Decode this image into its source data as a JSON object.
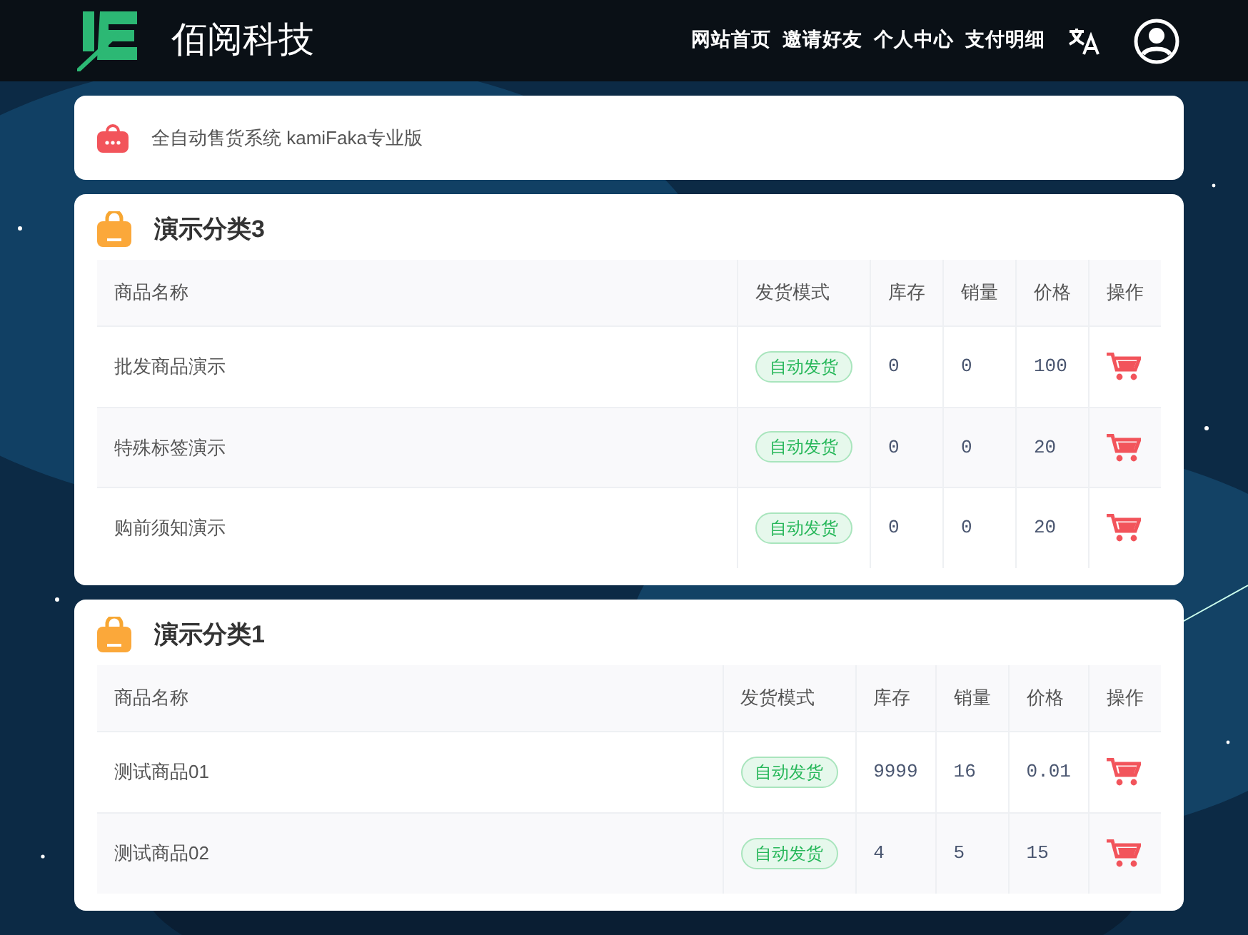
{
  "brand": {
    "title": "佰阅科技"
  },
  "nav": [
    "网站首页",
    "邀请好友",
    "个人中心",
    "支付明细"
  ],
  "notice": {
    "text": "全自动售货系统 kamiFaka专业版"
  },
  "categories": [
    {
      "title": "演示分类3",
      "columns": [
        "商品名称",
        "发货模式",
        "库存",
        "销量",
        "价格",
        "操作"
      ],
      "rows": [
        {
          "name": "批发商品演示",
          "mode": "自动发货",
          "stock": "0",
          "sales": "0",
          "price": "100"
        },
        {
          "name": "特殊标签演示",
          "mode": "自动发货",
          "stock": "0",
          "sales": "0",
          "price": "20"
        },
        {
          "name": "购前须知演示",
          "mode": "自动发货",
          "stock": "0",
          "sales": "0",
          "price": "20"
        }
      ]
    },
    {
      "title": "演示分类1",
      "columns": [
        "商品名称",
        "发货模式",
        "库存",
        "销量",
        "价格",
        "操作"
      ],
      "rows": [
        {
          "name": "测试商品01",
          "mode": "自动发货",
          "stock": "9999",
          "sales": "16",
          "price": "0.01"
        },
        {
          "name": "测试商品02",
          "mode": "自动发货",
          "stock": "4",
          "sales": "5",
          "price": "15"
        }
      ]
    }
  ]
}
